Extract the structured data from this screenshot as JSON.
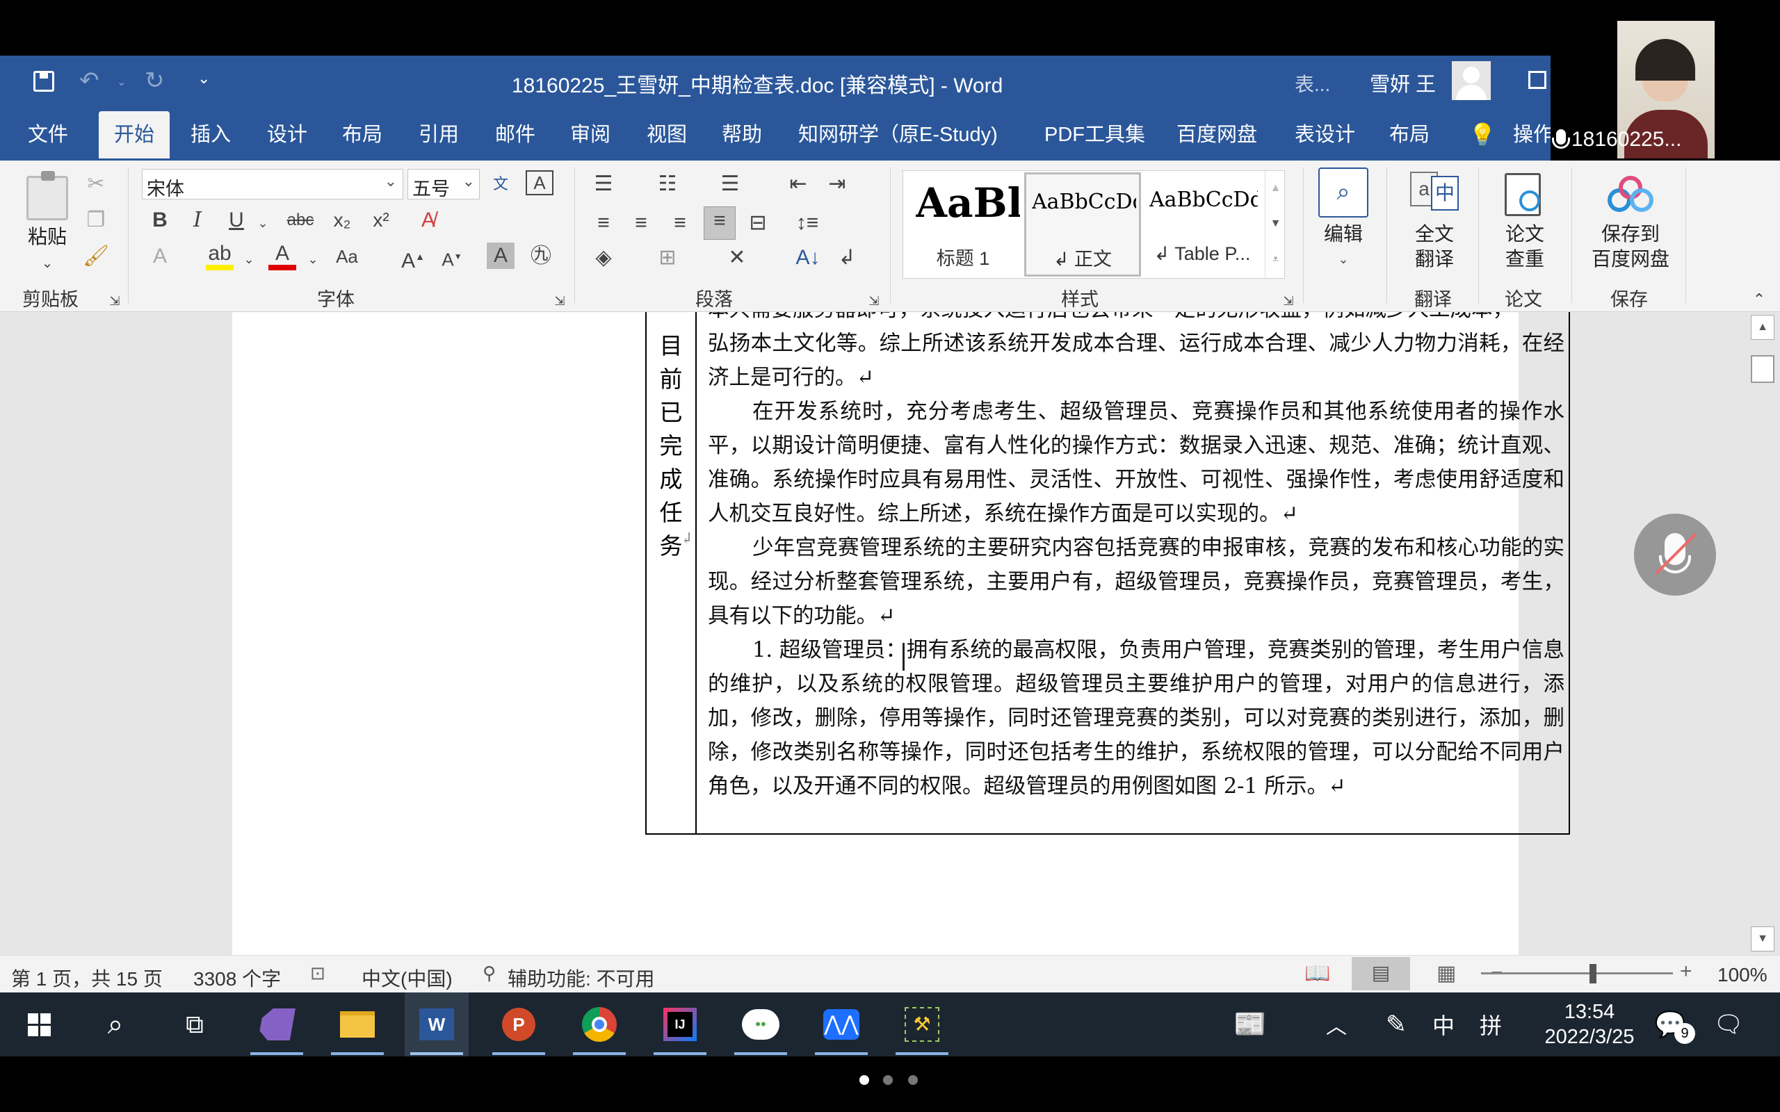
{
  "titlebar": {
    "title": "18160225_王雪妍_中期检查表.doc [兼容模式]  -  Word",
    "context_hint": "表...",
    "user_name": "雪妍 王"
  },
  "tabs": [
    "文件",
    "开始",
    "插入",
    "设计",
    "布局",
    "引用",
    "邮件",
    "审阅",
    "视图",
    "帮助",
    "知网研学（原E-Study)",
    "PDF工具集",
    "百度网盘",
    "表设计",
    "布局"
  ],
  "tell_me": "操作",
  "ribbon": {
    "clipboard": {
      "paste": "粘贴",
      "label": "剪贴板"
    },
    "font": {
      "name": "宋体",
      "size": "五号",
      "label": "字体"
    },
    "paragraph": {
      "label": "段落"
    },
    "styles": {
      "label": "样式",
      "items": [
        {
          "preview": "AaBl",
          "name": "标题 1"
        },
        {
          "preview": "AaBbCcDd",
          "name": "↲ 正文"
        },
        {
          "preview": "AaBbCcDd",
          "name": "↲ Table P..."
        }
      ]
    },
    "edit": {
      "label": "编辑"
    },
    "translate": {
      "button": "全文\n翻译",
      "label": "翻译"
    },
    "paper": {
      "button": "论文\n查重",
      "label": "论文"
    },
    "save": {
      "button": "保存到\n百度网盘",
      "label": "保存"
    }
  },
  "document": {
    "row_label": [
      "目",
      "前",
      "已",
      "完",
      "成",
      "任",
      "务"
    ],
    "top_partial": "本只需要服务器即可，系统投入运行后也会带来一定的无形收益，例如减少人工成本，",
    "paragraphs": [
      "弘扬本土文化等。综上所述该系统开发成本合理、运行成本合理、减少人力物力消耗，在经济上是可行的。↵",
      "在开发系统时，充分考虑考生、超级管理员、竞赛操作员和其他系统使用者的操作水平，以期设计简明便捷、富有人性化的操作方式：数据录入迅速、规范、准确；统计直观、准确。系统操作时应具有易用性、灵活性、开放性、可视性、强操作性，考虑使用舒适度和人机交互良好性。综上所述，系统在操作方面是可以实现的。↵",
      "少年宫竞赛管理系统的主要研究内容包括竞赛的申报审核，竞赛的发布和核心功能的实现。经过分析整套管理系统，主要用户有，超级管理员，竞赛操作员，竞赛管理员，考生，具有以下的功能。↵",
      "1. 超级管理员：拥有系统的最高权限，负责用户管理，竞赛类别的管理，考生用户信息的维护，以及系统的权限管理。超级管理员主要维护用户的管理，对用户的信息进行，添加，修改，删除，停用等操作，同时还管理竞赛的类别，可以对竞赛的类别进行，添加，删除，修改类别名称等操作，同时还包括考生的维护，系统权限的管理，可以分配给不同用户角色，以及开通不同的权限。超级管理员的用例图如图 2-1 所示。↵"
    ]
  },
  "statusbar": {
    "page": "第 1 页，共 15 页",
    "words": "3308 个字",
    "language": "中文(中国)",
    "accessibility": "辅助功能: 不可用",
    "zoom": "100%"
  },
  "taskbar": {
    "time": "13:54",
    "date": "2022/3/25",
    "ime_lang": "中",
    "ime_mode": "拼",
    "notifications": "9"
  },
  "webcam": {
    "name": "18160225..."
  }
}
